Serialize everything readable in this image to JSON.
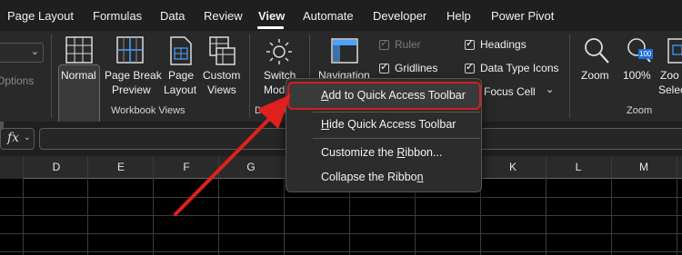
{
  "tabs": [
    {
      "label": "Page Layout",
      "active": false
    },
    {
      "label": "Formulas",
      "active": false
    },
    {
      "label": "Data",
      "active": false
    },
    {
      "label": "Review",
      "active": false
    },
    {
      "label": "View",
      "active": true
    },
    {
      "label": "Automate",
      "active": false
    },
    {
      "label": "Developer",
      "active": false
    },
    {
      "label": "Help",
      "active": false
    },
    {
      "label": "Power Pivot",
      "active": false
    }
  ],
  "ribbon": {
    "options_label": "Options",
    "workbook_views": {
      "group_label": "Workbook Views",
      "normal": "Normal",
      "page_break_1": "Page Break",
      "page_break_2": "Preview",
      "page_layout_1": "Page",
      "page_layout_2": "Layout",
      "custom_views_1": "Custom",
      "custom_views_2": "Views"
    },
    "dark_mode": {
      "group_label_partial": "Dark M",
      "switch_1": "Switch",
      "switch_2_partial": "Mod"
    },
    "show": {
      "navigation": "Navigation",
      "ruler": "Ruler",
      "ruler_checked": true,
      "ruler_disabled": true,
      "gridlines": "Gridlines",
      "gridlines_checked": true,
      "headings": "Headings",
      "headings_checked": true,
      "data_type_icons": "Data Type Icons",
      "data_type_icons_checked": true,
      "focus_cell": "Focus Cell"
    },
    "zoom": {
      "group_label": "Zoom",
      "zoom": "Zoom",
      "hundred": "100%",
      "hundred_icon_text": "100",
      "zoom_selection_1_partial": "Zoo",
      "zoom_selection_2_partial": "Selec"
    }
  },
  "formula_bar": {
    "fx": "fx"
  },
  "columns": [
    "D",
    "E",
    "F",
    "G",
    "K",
    "L",
    "M"
  ],
  "context_menu": {
    "items": [
      {
        "pre": "",
        "u": "A",
        "post": "dd to Quick Access Toolbar"
      },
      {
        "pre": "",
        "u": "H",
        "post": "ide Quick Access Toolbar"
      },
      {
        "pre": "Customize the ",
        "u": "R",
        "post": "ibbon..."
      },
      {
        "pre": "Collapse the Ribbo",
        "u": "n",
        "post": ""
      }
    ]
  },
  "colors": {
    "highlight_border": "#d21f1f",
    "arrow": "#e0201f",
    "checkbox_border": "#cfcfcf",
    "background": "#000000"
  }
}
